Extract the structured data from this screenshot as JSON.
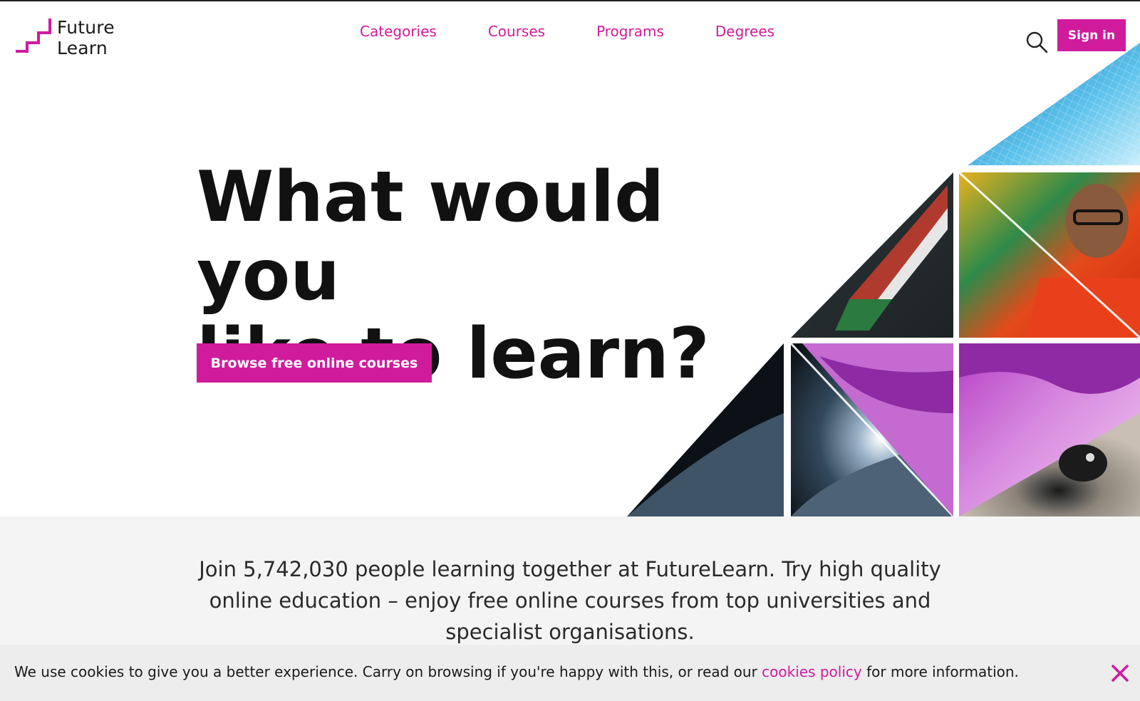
{
  "brand": {
    "name_line1": "Future",
    "name_line2": "Learn",
    "accent_color": "#d01b9d"
  },
  "nav": {
    "items": [
      {
        "label": "Categories"
      },
      {
        "label": "Courses"
      },
      {
        "label": "Programs"
      },
      {
        "label": "Degrees"
      }
    ]
  },
  "header": {
    "search_icon": "search-icon",
    "signin_label": "Sign in"
  },
  "hero": {
    "title_line1": "What would you",
    "title_line2": "like to learn?",
    "cta_label": "Browse free online courses",
    "images": [
      "wireframe-terrain",
      "container-ship",
      "boy-with-painting",
      "earth-from-space",
      "tissue-micrograph-1",
      "tissue-micrograph-2",
      "human-eye"
    ]
  },
  "intro": {
    "text": "Join 5,742,030 people learning together at FutureLearn. Try high quality online education – enjoy free online courses from top universities and specialist organisations."
  },
  "cookie": {
    "text_before": "We use cookies to give you a better experience. Carry on browsing if you're happy with this, or read our ",
    "link_label": "cookies policy",
    "text_after": " for more information.",
    "close_icon": "close-icon"
  }
}
